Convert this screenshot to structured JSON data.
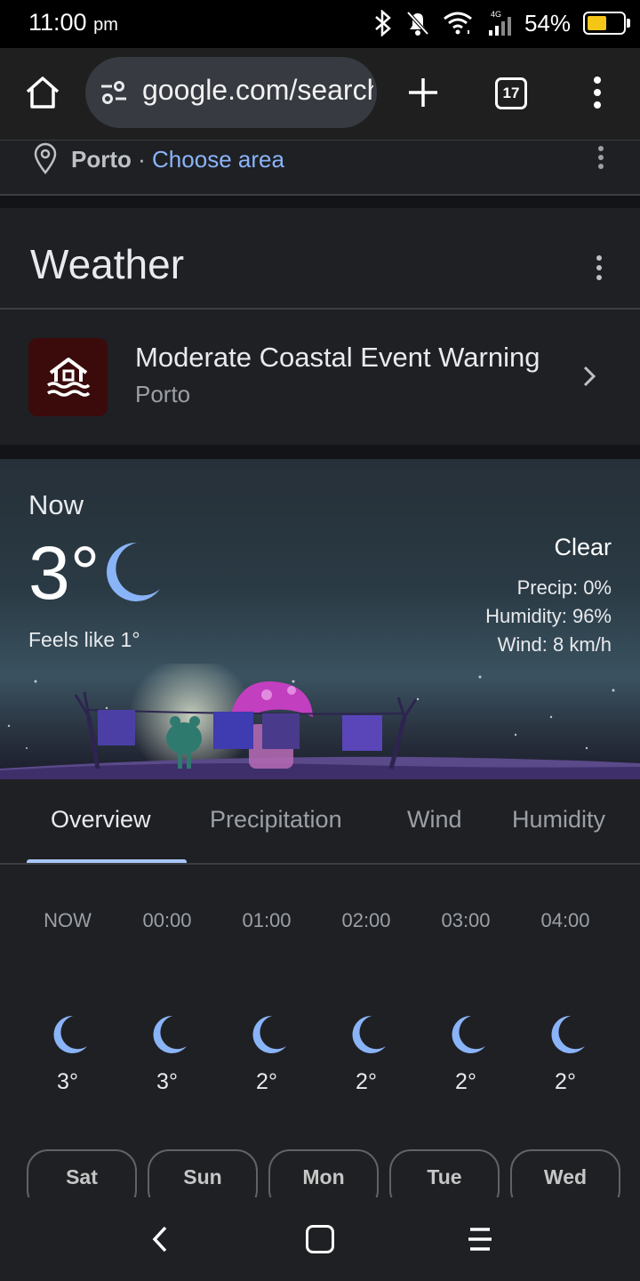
{
  "status_bar": {
    "time": "11:00",
    "ampm": "pm",
    "network": "4G",
    "battery_percent": "54%",
    "battery_level": 0.54,
    "icons": [
      "bluetooth-icon",
      "bell-off-icon",
      "wifi-icon",
      "signal-icon",
      "battery-icon"
    ]
  },
  "browser": {
    "url": "google.com/search",
    "tab_count": "17",
    "icons": [
      "home-icon",
      "site-settings-icon",
      "new-tab-icon",
      "tabs-icon",
      "menu-icon"
    ]
  },
  "location": {
    "city": "Porto",
    "separator": "·",
    "choose_area": "Choose area"
  },
  "weather": {
    "title": "Weather",
    "alert": {
      "title": "Moderate Coastal Event Warning",
      "place": "Porto"
    },
    "now": {
      "label": "Now",
      "temp": "3°",
      "feels_like": "Feels like 1°",
      "condition": "Clear",
      "precip": "Precip: 0%",
      "humidity": "Humidity: 96%",
      "wind": "Wind: 8 km/h"
    },
    "tabs": [
      "Overview",
      "Precipitation",
      "Wind",
      "Humidity"
    ],
    "hourly": [
      {
        "time": "NOW",
        "temp": "3°"
      },
      {
        "time": "00:00",
        "temp": "3°"
      },
      {
        "time": "01:00",
        "temp": "2°"
      },
      {
        "time": "02:00",
        "temp": "2°"
      },
      {
        "time": "03:00",
        "temp": "2°"
      },
      {
        "time": "04:00",
        "temp": "2°"
      }
    ],
    "days": [
      "Sat",
      "Sun",
      "Mon",
      "Tue",
      "Wed"
    ]
  },
  "colors": {
    "accent_link": "#8ab4f8",
    "tab_indicator": "#a8c7fa",
    "moon": "#8ab4f8",
    "alert_bg": "#3b0b0b",
    "battery": "#f5c518"
  }
}
